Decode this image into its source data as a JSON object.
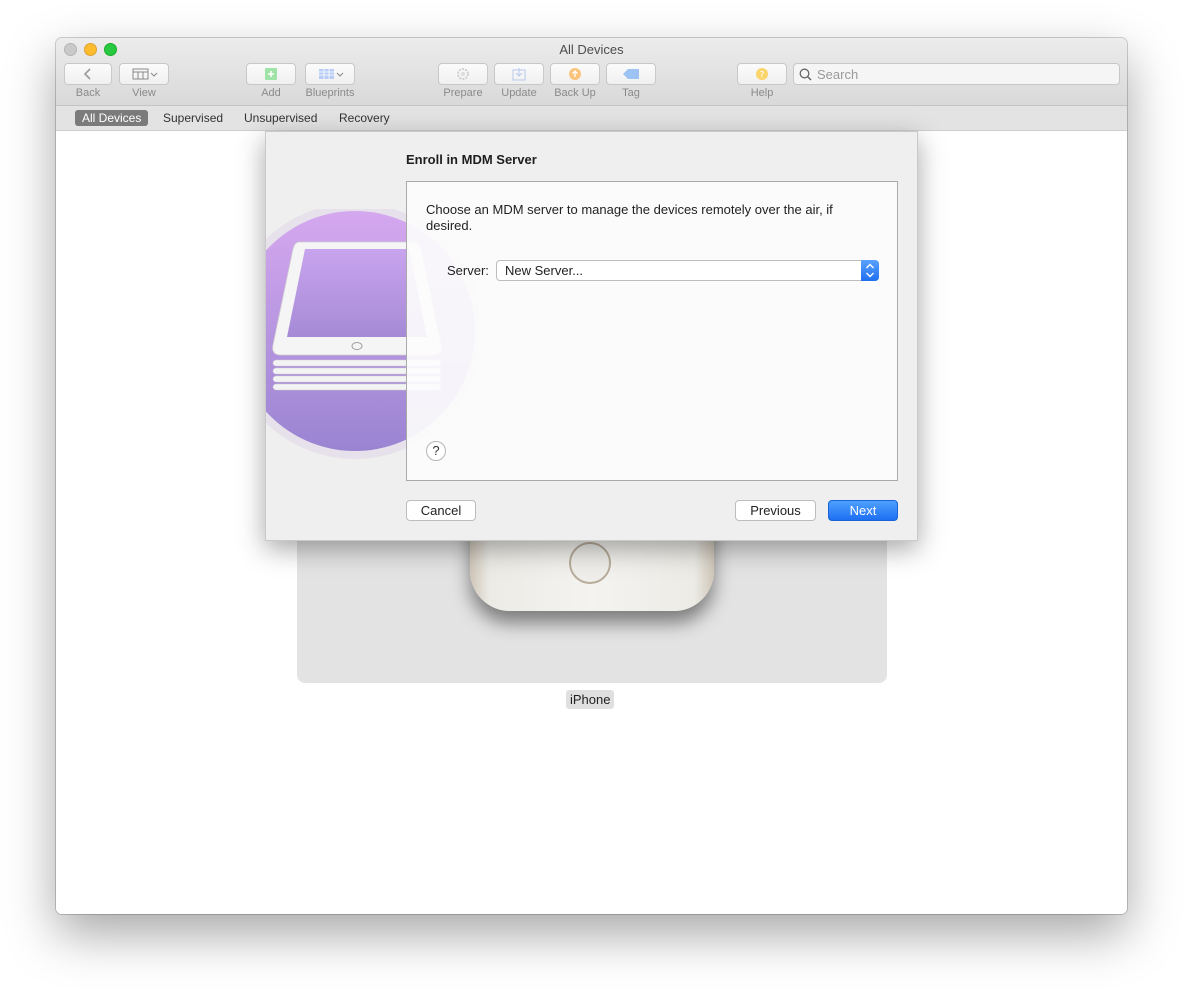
{
  "window": {
    "title": "All Devices"
  },
  "toolbar": {
    "back_label": "Back",
    "view_label": "View",
    "add_label": "Add",
    "blueprints_label": "Blueprints",
    "prepare_label": "Prepare",
    "update_label": "Update",
    "backup_label": "Back Up",
    "tag_label": "Tag",
    "help_label": "Help",
    "search_placeholder": "Search"
  },
  "scopes": [
    {
      "label": "All Devices",
      "active": true
    },
    {
      "label": "Supervised",
      "active": false
    },
    {
      "label": "Unsupervised",
      "active": false
    },
    {
      "label": "Recovery",
      "active": false
    }
  ],
  "device": {
    "name": "iPhone"
  },
  "sheet": {
    "title": "Enroll in MDM Server",
    "description": "Choose an MDM server to manage the devices remotely over the air, if desired.",
    "server_label": "Server:",
    "server_value": "New Server...",
    "help_symbol": "?",
    "cancel_label": "Cancel",
    "previous_label": "Previous",
    "next_label": "Next"
  },
  "colors": {
    "accent": "#1f6ff0",
    "close": "#c9c9c9",
    "minimize": "#fdbc2e",
    "maximize": "#28c940"
  }
}
